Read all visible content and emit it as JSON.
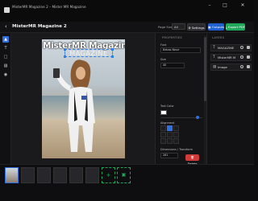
{
  "window": {
    "title": "MisterMR Magazine 2 – Mister MR Magazine",
    "controls": [
      "–",
      "□",
      "✕"
    ]
  },
  "header": {
    "back_icon": "chevron-left-icon",
    "project_title": "MisterMR Magazine 2",
    "page_size_label": "Page Size",
    "page_size_value": "All",
    "settings_label": "⚙ Settings",
    "outputs_label": "▣ Outputs",
    "export_label": "⤓ Export PDF",
    "colors": {
      "outputs": "#1f5fcf",
      "export": "#1fa85a"
    }
  },
  "toolbar": {
    "tools": [
      {
        "icon": "pointer-icon",
        "glyph": "▲",
        "active": true
      },
      {
        "icon": "text-icon",
        "glyph": "T"
      },
      {
        "icon": "shape-icon",
        "glyph": "□"
      },
      {
        "icon": "image-icon",
        "glyph": "▨"
      },
      {
        "icon": "effects-icon",
        "glyph": "◉"
      }
    ]
  },
  "canvas": {
    "masthead": "MisterMR Magazine",
    "subtitle": "MAGAZINE"
  },
  "properties": {
    "heading": "PROPERTIES",
    "font_label": "Font",
    "font_value": "Bebas Neue",
    "size_label": "Size",
    "size_value": "40",
    "color_label": "Text Color",
    "alignment_label": "Alignment",
    "dimensions_label": "Dimensions / Transform",
    "width_value": "281",
    "height_value": "40",
    "text_label": "Text",
    "text_value": "MAGAZINE",
    "delete_label": "🗑 Delete"
  },
  "layers": {
    "heading": "LAYERS",
    "items": [
      {
        "icon": "text-layer-icon",
        "glyph": "T",
        "name": "MAGAZINE"
      },
      {
        "icon": "text-layer-icon",
        "glyph": "T",
        "name": "MisterMR M"
      },
      {
        "icon": "image-layer-icon",
        "glyph": "▨",
        "name": "Image"
      }
    ]
  },
  "filmstrip": {
    "pages": [
      "",
      "",
      "",
      "",
      "",
      ""
    ],
    "add_page_icon": "plus-icon",
    "add_layout_icon": "layout-add-icon"
  }
}
